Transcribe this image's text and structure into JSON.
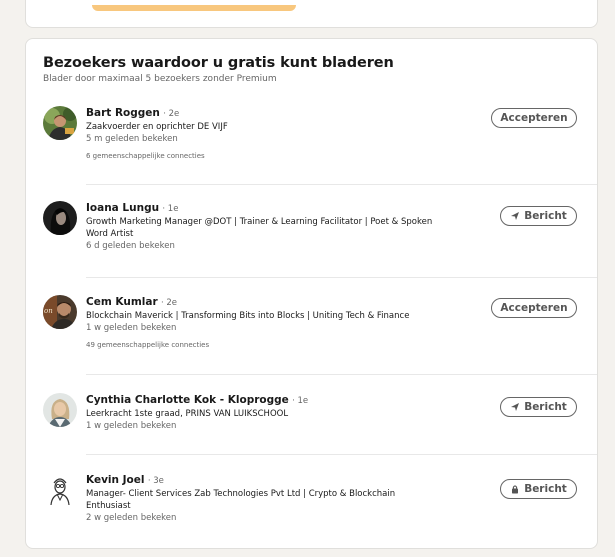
{
  "section": {
    "title": "Bezoekers waardoor u gratis kunt bladeren",
    "subtitle": "Blader door maximaal 5 bezoekers zonder Premium"
  },
  "visitors": [
    {
      "name": "Bart Roggen",
      "degree": "· 2e",
      "headline": "Zaakvoerder en oprichter DE VIJF",
      "viewed": "5 m geleden bekeken",
      "connections": "6 gemeenschappelijke connecties",
      "action": "Accepteren",
      "action_icon": "none"
    },
    {
      "name": "Ioana Lungu",
      "degree": "· 1e",
      "headline": "Growth Marketing Manager @DOT | Trainer & Learning Facilitator | Poet & Spoken Word Artist",
      "viewed": "6 d geleden bekeken",
      "connections": "",
      "action": "Bericht",
      "action_icon": "send-icon"
    },
    {
      "name": "Cem Kumlar",
      "degree": "· 2e",
      "headline": "Blockchain Maverick | Transforming Bits into Blocks | Uniting Tech & Finance",
      "viewed": "1 w geleden bekeken",
      "connections": "49 gemeenschappelijke connecties",
      "action": "Accepteren",
      "action_icon": "none"
    },
    {
      "name": "Cynthia Charlotte Kok - Kloprogge",
      "degree": "· 1e",
      "headline": "Leerkracht 1ste graad, PRINS VAN LUIKSCHOOL",
      "viewed": "1 w geleden bekeken",
      "connections": "",
      "action": "Bericht",
      "action_icon": "send-icon"
    },
    {
      "name": "Kevin Joel",
      "degree": "· 3e",
      "headline": "Manager- Client Services Zab Technologies Pvt Ltd | Crypto & Blockchain Enthusiast",
      "viewed": "2 w geleden bekeken",
      "connections": "",
      "action": "Bericht",
      "action_icon": "lock-icon"
    }
  ],
  "colors": {
    "background": "#f4f2ee",
    "card": "#ffffff",
    "accent_bar": "#f8c77e",
    "text": "#191919",
    "muted": "#666666"
  }
}
